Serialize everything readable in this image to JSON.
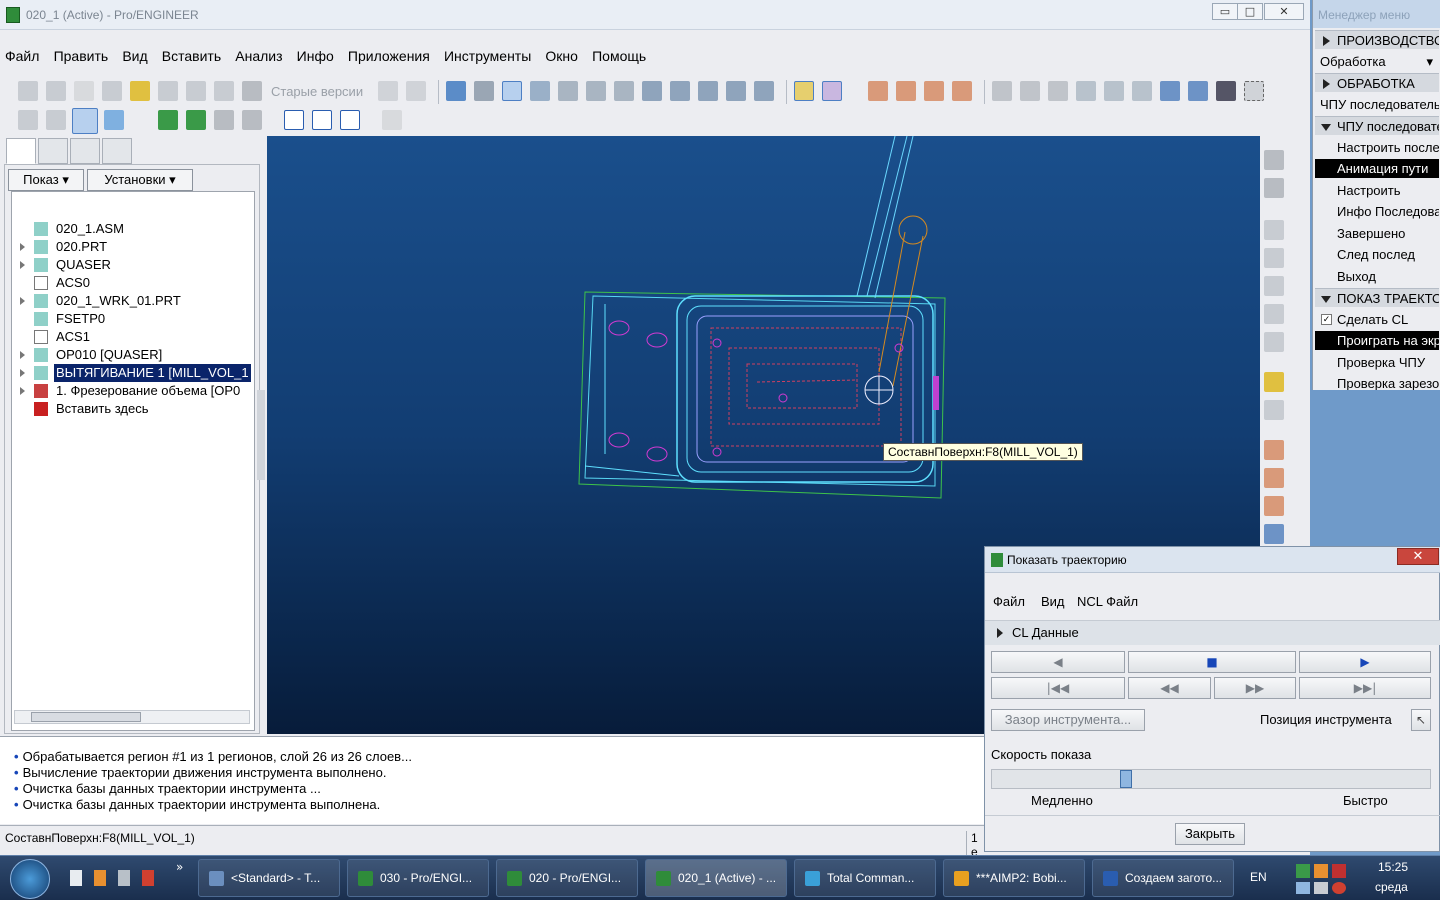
{
  "window": {
    "title": "020_1 (Active) - Pro/ENGINEER",
    "minimize": "▭",
    "restore": "□",
    "close": "✕"
  },
  "menubar": [
    "Файл",
    "Править",
    "Вид",
    "Вставить",
    "Анализ",
    "Инфо",
    "Приложения",
    "Инструменты",
    "Окно",
    "Помощь"
  ],
  "toolbar": {
    "old_versions": "Старые версии"
  },
  "nav": {
    "show_label": "Показ",
    "settings_label": "Установки"
  },
  "tree": [
    {
      "label": "020_1.ASM",
      "icon": "assembly-icon",
      "expand": false
    },
    {
      "label": "020.PRT",
      "icon": "part-icon",
      "expand": true
    },
    {
      "label": "QUASER",
      "icon": "machine-icon",
      "expand": true
    },
    {
      "label": "ACS0",
      "icon": "csys-icon",
      "expand": false
    },
    {
      "label": "020_1_WRK_01.PRT",
      "icon": "workpiece-icon",
      "expand": true
    },
    {
      "label": "FSETP0",
      "icon": "fixture-icon",
      "expand": false
    },
    {
      "label": "ACS1",
      "icon": "csys-icon",
      "expand": false
    },
    {
      "label": "OP010 [QUASER]",
      "icon": "operation-icon",
      "expand": true
    },
    {
      "label": "ВЫТЯГИВАНИЕ 1 [MILL_VOL_1",
      "icon": "extrude-icon",
      "expand": true,
      "selected": true
    },
    {
      "label": "1. Фрезерование объема [OP0",
      "icon": "toolpath-icon",
      "expand": true
    },
    {
      "label": "Вставить здесь",
      "icon": "insert-arrow-icon",
      "expand": false
    }
  ],
  "viewport": {
    "tooltip": "СоставнПоверхн:F8(MILL_VOL_1)"
  },
  "messages": [
    "Обрабатывается регион #1 из 1 регионов, слой 26 из 26 слоев...",
    "Вычисление траектории движения инструмента выполнено.",
    "Очистка базы данных траектории инструмента ...",
    "Очистка базы данных траектории инструмента выполнена."
  ],
  "status": {
    "left": "СоставнПоверхн:F8(MILL_VOL_1)",
    "right": "1 е"
  },
  "menu_manager": {
    "title": "Менеджер меню",
    "items": [
      {
        "label": "ПРОИЗВОДСТВО",
        "type": "hdr"
      },
      {
        "label": "Обработка",
        "type": "dropdown"
      },
      {
        "label": "ОБРАБОТКА",
        "type": "hdr"
      },
      {
        "label": "ЧПУ последовательность",
        "type": "plain"
      },
      {
        "label": "ЧПУ последовательность",
        "type": "hdr-open"
      },
      {
        "label": "Настроить последовательность",
        "type": "item"
      },
      {
        "label": "Анимация пути",
        "type": "sel"
      },
      {
        "label": "Настроить",
        "type": "item"
      },
      {
        "label": "Инфо Последовательность",
        "type": "item"
      },
      {
        "label": "Завершено",
        "type": "item"
      },
      {
        "label": "След послед",
        "type": "item"
      },
      {
        "label": "Выход",
        "type": "item"
      },
      {
        "label": "ПОКАЗ ТРАЕКТОРИИ",
        "type": "hdr-open"
      },
      {
        "label": "Сделать CL",
        "type": "check"
      },
      {
        "label": "Проиграть на экране",
        "type": "sel"
      },
      {
        "label": "Проверка ЧПУ",
        "type": "item"
      },
      {
        "label": "Проверка зарезов",
        "type": "item"
      }
    ]
  },
  "dialog": {
    "title": "Показать траекторию",
    "close": "✕",
    "menu": [
      "Файл",
      "Вид",
      "NCL Файл"
    ],
    "cl_section": "CL Данные",
    "tool_clearance": "Зазор инструмента...",
    "tool_position": "Позиция инструмента",
    "speed_label": "Скорость показа",
    "slow": "Медленно",
    "fast": "Быстро",
    "close_button": "Закрыть",
    "speed_value": 0.3
  },
  "taskbar": {
    "items": [
      {
        "label": "<Standard> - T...",
        "color": "#6b8fbf"
      },
      {
        "label": "030 - Pro/ENGI...",
        "color": "#2f8c3a"
      },
      {
        "label": "020 - Pro/ENGI...",
        "color": "#2f8c3a"
      },
      {
        "label": "020_1 (Active) - ...",
        "color": "#2f8c3a",
        "active": true
      },
      {
        "label": "Total Comman...",
        "color": "#3aa0d8"
      },
      {
        "label": "***AIMP2: Bobi...",
        "color": "#e8a020"
      },
      {
        "label": "Создаем загото...",
        "color": "#2a5db0"
      }
    ],
    "lang": "EN",
    "time": "15:25",
    "day": "среда",
    "more": "»"
  }
}
